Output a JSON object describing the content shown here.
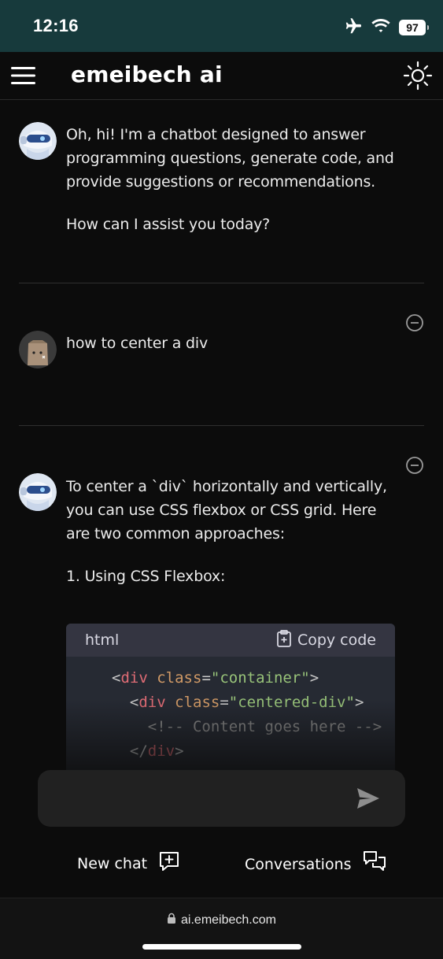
{
  "status_bar": {
    "time": "12:16",
    "battery": "97"
  },
  "header": {
    "title": "emeibech ai"
  },
  "messages": [
    {
      "role": "bot",
      "paragraphs": [
        "Oh, hi! I'm a chatbot designed to answer programming questions, generate code, and provide suggestions or recommendations.",
        "How can I assist you today?"
      ]
    },
    {
      "role": "user",
      "paragraphs": [
        "how to center a div"
      ]
    },
    {
      "role": "bot",
      "paragraphs": [
        "To center a `div` horizontally and vertically, you can use CSS flexbox or CSS grid. Here are two common approaches:",
        "1. Using CSS Flexbox:"
      ],
      "code": {
        "language": "html",
        "copy_label": "Copy code",
        "lines": [
          "<div class=\"container\">",
          "  <div class=\"centered-div\">",
          "    <!-- Content goes here -->",
          "  </div>"
        ]
      }
    }
  ],
  "input": {
    "value": "",
    "placeholder": ""
  },
  "actions": {
    "new_chat": "New chat",
    "conversations": "Conversations"
  },
  "url_bar": {
    "domain": "ai.emeibech.com"
  },
  "icons": {
    "status": [
      "airplane-icon",
      "wifi-icon",
      "battery-icon"
    ],
    "header": [
      "hamburger-menu-icon",
      "sun-icon"
    ],
    "message": [
      "bot-avatar",
      "user-avatar",
      "minus-circle-icon",
      "clipboard-icon"
    ],
    "footer": [
      "send-icon",
      "new-chat-icon",
      "conversations-icon",
      "lock-icon"
    ]
  },
  "colors": {
    "status_bar": "#173a3c",
    "background": "#0c0c0c",
    "code_background": "#262a33",
    "input_background": "#212121"
  }
}
